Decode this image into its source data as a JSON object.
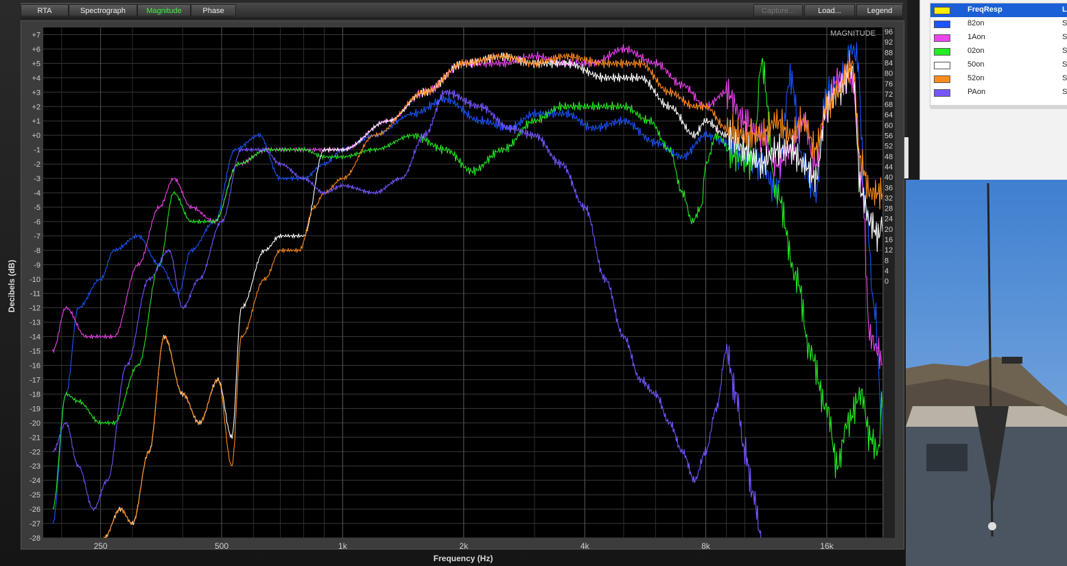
{
  "toolbar": {
    "tabs": [
      {
        "label": "RTA",
        "active": false
      },
      {
        "label": "Spectrograph",
        "active": false
      },
      {
        "label": "Magnitude",
        "active": true
      },
      {
        "label": "Phase",
        "active": false
      }
    ],
    "right_buttons": [
      {
        "label": "Capture...",
        "enabled": false
      },
      {
        "label": "Load...",
        "enabled": true
      },
      {
        "label": "Legend",
        "enabled": true
      }
    ]
  },
  "graph": {
    "view_label": "MAGNITUDE",
    "y_axis_label": "Decibels (dB)",
    "x_axis_label": "Frequency (Hz)",
    "y_ticks": [
      "+7",
      "+6",
      "+5",
      "+4",
      "+3",
      "+2",
      "+1",
      "+0",
      "-1",
      "-2",
      "-3",
      "-4",
      "-5",
      "-6",
      "-7",
      "-8",
      "-9",
      "-10",
      "-11",
      "-12",
      "-13",
      "-14",
      "-15",
      "-16",
      "-17",
      "-18",
      "-19",
      "-20",
      "-21",
      "-22",
      "-23",
      "-24",
      "-25",
      "-26",
      "-27",
      "-28"
    ],
    "right_ticks": [
      "96",
      "92",
      "88",
      "84",
      "80",
      "76",
      "72",
      "68",
      "64",
      "60",
      "56",
      "52",
      "48",
      "44",
      "40",
      "36",
      "32",
      "28",
      "24",
      "20",
      "16",
      "12",
      "8",
      "4",
      "0"
    ],
    "x_ticks": [
      "250",
      "500",
      "1k",
      "2k",
      "4k",
      "8k",
      "16k"
    ],
    "x_range_hz": [
      180,
      22000
    ],
    "y_range_db": [
      -28,
      7.5
    ],
    "grid": true,
    "background": "#000000"
  },
  "legend": {
    "items": [
      {
        "name": "FreqResp",
        "color": "#ffee00",
        "extra": "Li",
        "selected": true
      },
      {
        "name": "82on",
        "color": "#1a55ff",
        "extra": "St",
        "selected": false
      },
      {
        "name": "1Aon",
        "color": "#ee44ee",
        "extra": "St",
        "selected": false
      },
      {
        "name": "02on",
        "color": "#22ee22",
        "extra": "St",
        "selected": false
      },
      {
        "name": "50on",
        "color": "#ffffff",
        "extra": "St",
        "selected": false
      },
      {
        "name": "52on",
        "color": "#ff8c1a",
        "extra": "St",
        "selected": false
      },
      {
        "name": "PAon",
        "color": "#7755ff",
        "extra": "St",
        "selected": false
      }
    ]
  },
  "chart_data": {
    "type": "line",
    "x_scale": "log",
    "xlabel": "Frequency (Hz)",
    "ylabel": "Decibels (dB)",
    "xlim": [
      180,
      22000
    ],
    "ylim": [
      -28,
      7.5
    ],
    "series": [
      {
        "name": "82on",
        "color": "#1a55ff",
        "points": [
          [
            190,
            -27
          ],
          [
            205,
            -18
          ],
          [
            220,
            -12
          ],
          [
            250,
            -10
          ],
          [
            270,
            -8
          ],
          [
            310,
            -7
          ],
          [
            350,
            -9
          ],
          [
            390,
            -11
          ],
          [
            420,
            -8
          ],
          [
            480,
            -6
          ],
          [
            540,
            -1
          ],
          [
            620,
            0
          ],
          [
            700,
            -3
          ],
          [
            800,
            -3
          ],
          [
            900,
            -2
          ],
          [
            1000,
            -1
          ],
          [
            1200,
            0
          ],
          [
            1500,
            1.5
          ],
          [
            1800,
            2.5
          ],
          [
            2200,
            1
          ],
          [
            2600,
            0.5
          ],
          [
            3000,
            1.5
          ],
          [
            3600,
            1.5
          ],
          [
            4200,
            0.5
          ],
          [
            5000,
            1
          ],
          [
            6000,
            -0.5
          ],
          [
            7000,
            -1.5
          ],
          [
            8000,
            0
          ],
          [
            9000,
            -0.5
          ],
          [
            10000,
            -1.5
          ],
          [
            11000,
            -2
          ],
          [
            12000,
            -4
          ],
          [
            13000,
            4
          ],
          [
            14000,
            -2
          ],
          [
            15000,
            -4
          ],
          [
            16000,
            3
          ],
          [
            17500,
            4
          ],
          [
            18500,
            6
          ],
          [
            19000,
            5.5
          ],
          [
            20000,
            -5
          ],
          [
            21000,
            -12
          ],
          [
            22000,
            -20
          ]
        ]
      },
      {
        "name": "1Aon",
        "color": "#ee44ee",
        "points": [
          [
            190,
            -15
          ],
          [
            205,
            -12
          ],
          [
            230,
            -14
          ],
          [
            270,
            -14
          ],
          [
            310,
            -9
          ],
          [
            350,
            -5
          ],
          [
            380,
            -3
          ],
          [
            420,
            -5
          ],
          [
            480,
            -6
          ],
          [
            550,
            -2
          ],
          [
            650,
            -1
          ],
          [
            800,
            -1
          ],
          [
            900,
            -1
          ],
          [
            1000,
            -1
          ],
          [
            1300,
            1
          ],
          [
            1600,
            3
          ],
          [
            2000,
            5
          ],
          [
            2500,
            5
          ],
          [
            3000,
            5.5
          ],
          [
            3600,
            5
          ],
          [
            4200,
            5
          ],
          [
            5000,
            6
          ],
          [
            6000,
            5
          ],
          [
            7000,
            3.5
          ],
          [
            8000,
            2
          ],
          [
            9000,
            3
          ],
          [
            10000,
            1
          ],
          [
            11000,
            0
          ],
          [
            12000,
            -2
          ],
          [
            13000,
            -1
          ],
          [
            14000,
            1
          ],
          [
            15000,
            -2
          ],
          [
            16000,
            2
          ],
          [
            17000,
            4
          ],
          [
            18500,
            4
          ],
          [
            19500,
            -3
          ],
          [
            20500,
            -14
          ],
          [
            21500,
            -15
          ],
          [
            22000,
            -16
          ]
        ]
      },
      {
        "name": "02on",
        "color": "#22ee22",
        "points": [
          [
            190,
            -26
          ],
          [
            205,
            -18
          ],
          [
            220,
            -18.5
          ],
          [
            250,
            -20
          ],
          [
            270,
            -20
          ],
          [
            310,
            -16
          ],
          [
            350,
            -9
          ],
          [
            380,
            -4
          ],
          [
            420,
            -6
          ],
          [
            480,
            -6
          ],
          [
            550,
            -2
          ],
          [
            650,
            -1
          ],
          [
            800,
            -1
          ],
          [
            900,
            -1.5
          ],
          [
            1000,
            -1.5
          ],
          [
            1200,
            -1
          ],
          [
            1500,
            0
          ],
          [
            1800,
            -1
          ],
          [
            2100,
            -2.5
          ],
          [
            2500,
            -1
          ],
          [
            3000,
            1
          ],
          [
            3500,
            2
          ],
          [
            4200,
            2
          ],
          [
            5000,
            2
          ],
          [
            5800,
            1
          ],
          [
            6500,
            -1
          ],
          [
            7000,
            -4
          ],
          [
            7400,
            -6
          ],
          [
            7800,
            -5
          ],
          [
            8000,
            -2
          ],
          [
            8500,
            0
          ],
          [
            9500,
            -1.5
          ],
          [
            10500,
            -2
          ],
          [
            11000,
            5
          ],
          [
            12000,
            -4
          ],
          [
            13500,
            -10
          ],
          [
            14500,
            -15
          ],
          [
            16000,
            -19
          ],
          [
            17000,
            -23
          ],
          [
            18000,
            -20
          ],
          [
            19500,
            -18
          ],
          [
            20500,
            -21
          ],
          [
            21500,
            -22
          ],
          [
            22000,
            -18
          ]
        ]
      },
      {
        "name": "50on",
        "color": "#ffffff",
        "points": [
          [
            255,
            -28
          ],
          [
            280,
            -26
          ],
          [
            300,
            -27
          ],
          [
            330,
            -22
          ],
          [
            360,
            -14
          ],
          [
            400,
            -18
          ],
          [
            440,
            -20
          ],
          [
            490,
            -17
          ],
          [
            530,
            -21
          ],
          [
            560,
            -12
          ],
          [
            640,
            -8
          ],
          [
            700,
            -7
          ],
          [
            800,
            -7
          ],
          [
            900,
            -1
          ],
          [
            1000,
            -1
          ],
          [
            1300,
            1
          ],
          [
            1600,
            3
          ],
          [
            2000,
            5
          ],
          [
            2500,
            5.5
          ],
          [
            3000,
            5
          ],
          [
            3600,
            5
          ],
          [
            4500,
            4
          ],
          [
            5500,
            4
          ],
          [
            6500,
            2
          ],
          [
            7500,
            0
          ],
          [
            8000,
            1
          ],
          [
            9000,
            0
          ],
          [
            10000,
            -1
          ],
          [
            11000,
            -2
          ],
          [
            12000,
            -1
          ],
          [
            13000,
            -1
          ],
          [
            14000,
            -2
          ],
          [
            15000,
            -3
          ],
          [
            16000,
            2
          ],
          [
            17000,
            3
          ],
          [
            18500,
            4.5
          ],
          [
            19500,
            -4
          ],
          [
            20500,
            -6
          ],
          [
            21500,
            -7
          ],
          [
            22000,
            -6
          ]
        ]
      },
      {
        "name": "52on",
        "color": "#ff8c1a",
        "points": [
          [
            255,
            -28
          ],
          [
            280,
            -26
          ],
          [
            300,
            -27
          ],
          [
            330,
            -22
          ],
          [
            360,
            -14
          ],
          [
            400,
            -18
          ],
          [
            440,
            -20
          ],
          [
            490,
            -17
          ],
          [
            530,
            -23
          ],
          [
            560,
            -14
          ],
          [
            640,
            -10
          ],
          [
            700,
            -8
          ],
          [
            780,
            -8
          ],
          [
            850,
            -5
          ],
          [
            900,
            -4
          ],
          [
            1000,
            -3
          ],
          [
            1200,
            0
          ],
          [
            1600,
            3
          ],
          [
            2000,
            5
          ],
          [
            2500,
            5.5
          ],
          [
            3000,
            5
          ],
          [
            3600,
            5.5
          ],
          [
            4500,
            5
          ],
          [
            5500,
            5
          ],
          [
            6500,
            3
          ],
          [
            7500,
            2
          ],
          [
            8000,
            2
          ],
          [
            9000,
            0.5
          ],
          [
            10000,
            0
          ],
          [
            11000,
            0
          ],
          [
            12000,
            1
          ],
          [
            13000,
            0
          ],
          [
            14000,
            1
          ],
          [
            15000,
            -1
          ],
          [
            16000,
            2
          ],
          [
            17000,
            3
          ],
          [
            18500,
            5
          ],
          [
            19500,
            -2
          ],
          [
            20500,
            -4
          ],
          [
            21500,
            -4
          ],
          [
            22000,
            -4
          ]
        ]
      },
      {
        "name": "PAon",
        "color": "#7755ff",
        "points": [
          [
            190,
            -22
          ],
          [
            205,
            -20
          ],
          [
            220,
            -23
          ],
          [
            240,
            -26
          ],
          [
            260,
            -24
          ],
          [
            290,
            -16
          ],
          [
            330,
            -10
          ],
          [
            370,
            -8
          ],
          [
            400,
            -12
          ],
          [
            440,
            -10
          ],
          [
            500,
            -6
          ],
          [
            560,
            -1
          ],
          [
            640,
            -1
          ],
          [
            700,
            -2
          ],
          [
            800,
            -3
          ],
          [
            900,
            -4
          ],
          [
            1000,
            -3.5
          ],
          [
            1200,
            -4
          ],
          [
            1400,
            -3
          ],
          [
            1600,
            0
          ],
          [
            1800,
            3
          ],
          [
            2200,
            2
          ],
          [
            2600,
            0.5
          ],
          [
            3000,
            0
          ],
          [
            3500,
            -2
          ],
          [
            4000,
            -5
          ],
          [
            4500,
            -10
          ],
          [
            5000,
            -14
          ],
          [
            5500,
            -17
          ],
          [
            6000,
            -18
          ],
          [
            6500,
            -20
          ],
          [
            7000,
            -22
          ],
          [
            7500,
            -24
          ],
          [
            8000,
            -22
          ],
          [
            8500,
            -19
          ],
          [
            9000,
            -15
          ],
          [
            9500,
            -18
          ],
          [
            10000,
            -22
          ],
          [
            10500,
            -25
          ],
          [
            11000,
            -28
          ]
        ]
      }
    ]
  }
}
